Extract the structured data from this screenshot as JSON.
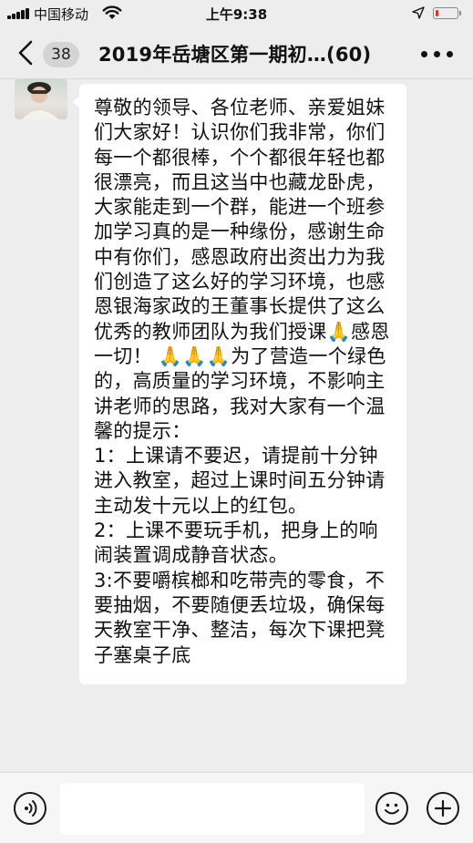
{
  "status_bar": {
    "carrier": "中国移动",
    "time": "上午9:38",
    "battery_level": 0.15,
    "battery_color": "#e0332d"
  },
  "nav": {
    "back_icon": "chevron-left-icon",
    "unread_count": "38",
    "title": "2019年岳塘区第一期初…(60)",
    "more_icon": "ellipsis-icon"
  },
  "message": {
    "avatar_icon": "user-avatar",
    "text": "尊敬的领导、各位老师、亲爱姐妹们大家好！认识你们我非常，你们每一个都很棒，个个都很年轻也都很漂亮，而且这当中也藏龙卧虎，大家能走到一个群，能进一个班参加学习真的是一种缘份，感谢生命中有你们，感恩政府出资出力为我们创造了这么好的学习环境，也感恩银海家政的王董事长提供了这么优秀的教师团队为我们授课🙏感恩一切！ 🙏🙏🙏为了营造一个绿色的，高质量的学习环境，不影响主讲老师的思路，我对大家有一个温馨的提示：\n1：上课请不要迟，请提前十分钟进入教室，超过上课时间五分钟请主动发十元以上的红包。\n2：上课不要玩手机，把身上的响闹装置调成静音状态。\n3:不要嚼槟榔和吃带壳的零食，不要抽烟，不要随便丢垃圾，确保每天教室干净、整洁，每次下课把凳子塞桌子底"
  },
  "input_bar": {
    "voice_icon": "voice-icon",
    "emoji_icon": "emoji-icon",
    "plus_icon": "plus-icon",
    "input_value": ""
  }
}
